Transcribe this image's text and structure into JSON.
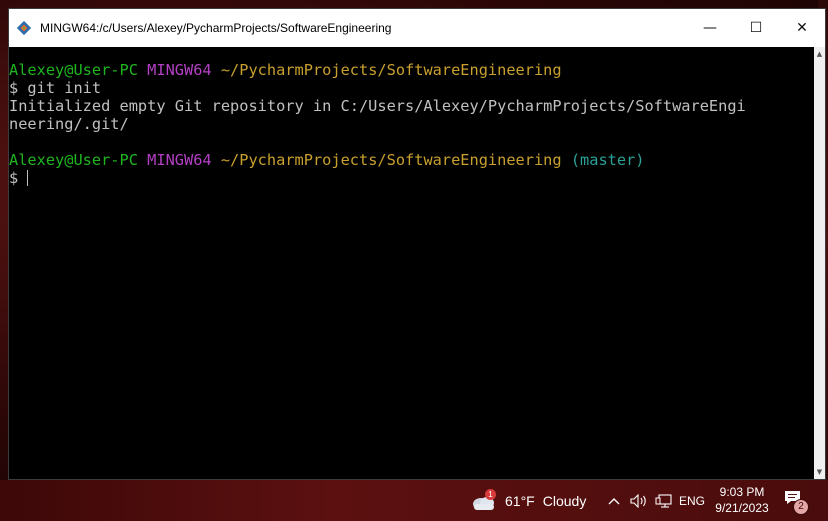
{
  "window": {
    "title": "MINGW64:/c/Users/Alexey/PycharmProjects/SoftwareEngineering",
    "minimize_glyph": "—",
    "maximize_glyph": "☐",
    "close_glyph": "✕"
  },
  "terminal": {
    "prompt1": {
      "user": "Alexey@User-PC",
      "env": "MINGW64",
      "path": "~/PycharmProjects/SoftwareEngineering"
    },
    "command": "$ git init",
    "output_line1": "Initialized empty Git repository in C:/Users/Alexey/PycharmProjects/SoftwareEngi",
    "output_line2": "neering/.git/",
    "prompt2": {
      "user": "Alexey@User-PC",
      "env": "MINGW64",
      "path": "~/PycharmProjects/SoftwareEngineering",
      "branch": "(master)"
    },
    "input_prompt": "$ "
  },
  "taskbar": {
    "weather_badge": "1",
    "temperature": "61°F",
    "condition": "Cloudy",
    "tray_chevron": "^",
    "language": "ENG",
    "time": "9:03 PM",
    "date": "9/21/2023",
    "notification_count": "2"
  },
  "colors": {
    "user": "#1fb51f",
    "env": "#b340c4",
    "path": "#c8a02e",
    "branch": "#2aa198"
  }
}
